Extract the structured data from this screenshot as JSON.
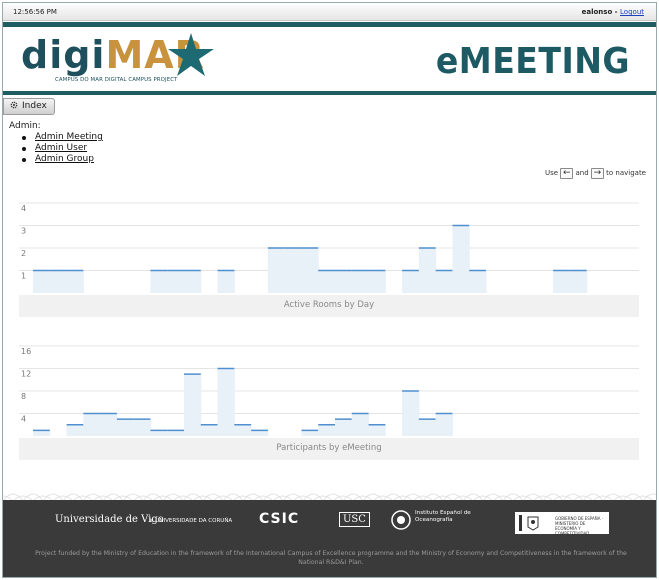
{
  "topbar": {
    "time": "12:56:56 PM",
    "user": "ealonso",
    "separator": " - ",
    "logout": "Logout"
  },
  "header": {
    "logo_part1": "digi",
    "logo_part2": "MAR",
    "logo_sub": "CAMPUS DO MAR DIGITAL CAMPUS PROJECT",
    "app_title": "eMEETING"
  },
  "colors": {
    "teal": "#1f5d63",
    "gold": "#c8933c",
    "bar_fill": "#e8f0f8",
    "bar_line": "#4f8fcf"
  },
  "menu": {
    "index_label": "Index",
    "index_icon": "gear-icon"
  },
  "admin": {
    "label": "Admin:",
    "links": [
      "Admin Meeting",
      "Admin User",
      "Admin Group"
    ]
  },
  "nav_hint": {
    "use": "Use",
    "and": "and",
    "to": "to navigate",
    "left_key": "←",
    "right_key": "→"
  },
  "chart_data": [
    {
      "type": "step-area",
      "title": "Active Rooms by Day",
      "y_ticks": [
        "4",
        "3",
        "2",
        "1"
      ],
      "ylim": [
        0,
        4
      ],
      "values": [
        1,
        1,
        1,
        0,
        0,
        0,
        0,
        1,
        1,
        1,
        0,
        1,
        0,
        0,
        2,
        2,
        2,
        1,
        1,
        1,
        1,
        0,
        1,
        2,
        1,
        3,
        1,
        0,
        0,
        0,
        0,
        1,
        1,
        0,
        0,
        0
      ],
      "grid": true
    },
    {
      "type": "step-area",
      "title": "Participants by eMeeting",
      "y_ticks": [
        "16",
        "12",
        "8",
        "4"
      ],
      "ylim": [
        0,
        16
      ],
      "values": [
        1,
        0,
        2,
        4,
        4,
        3,
        3,
        1,
        1,
        11,
        2,
        12,
        2,
        1,
        0,
        0,
        1,
        2,
        3,
        4,
        2,
        0,
        8,
        3,
        4,
        0,
        0,
        0,
        0,
        0,
        0,
        0,
        0,
        0,
        0,
        0
      ],
      "grid": true
    }
  ],
  "footer": {
    "logos": [
      "Universidade de Vigo",
      "UNIVERSIDADE DA CORUÑA",
      "CSIC",
      "USC",
      "Instituto Español de Oceanografía",
      "GOBIERNO DE ESPAÑA · MINISTERIO DE ECONOMÍA Y COMPETITIVIDAD"
    ],
    "note": "Project funded by the Ministry of Education in the framework of the International Campus of Excellence programme and the Ministry of Economy and Competitiveness in the framework of the National R&D&I Plan."
  }
}
